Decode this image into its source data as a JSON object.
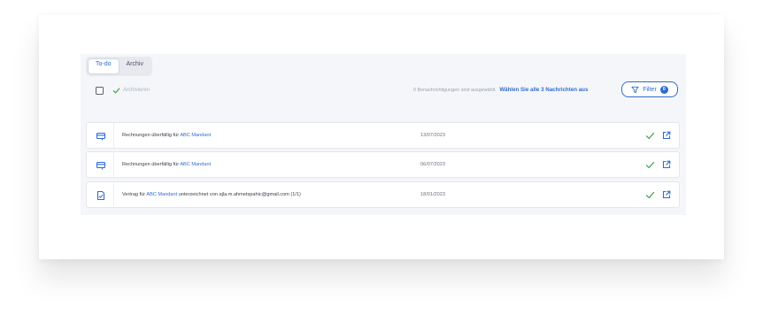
{
  "tabs": [
    {
      "label": "To-do",
      "active": true
    },
    {
      "label": "Archiv",
      "active": false
    }
  ],
  "toolbar": {
    "archive_label": "Archivieren",
    "selection_text": "0 Benachrichtigungen sind ausgewählt.",
    "select_all_link": "Wählen Sie alle 3 Nachrichten aus",
    "filter_label": "Filter",
    "filter_count": "0"
  },
  "rows": [
    {
      "icon": "invoice-icon",
      "text": "Rechnungen überfällig für ",
      "link": "ABC Mandant",
      "text_after": "",
      "date": "13/07/2023"
    },
    {
      "icon": "invoice-icon",
      "text": "Rechnungen überfällig für ",
      "link": "ABC Mandant",
      "text_after": "",
      "date": "06/07/2023"
    },
    {
      "icon": "document-icon",
      "text": "Vertrag für ",
      "link": "ABC Mandant",
      "text_after": " unterzeichnet von ajla.m.ahmetspahic@gmail.com (1/1)",
      "date": "18/01/2023"
    }
  ],
  "colors": {
    "accent": "#2f6bd1",
    "check": "#3aa14a",
    "panel": "#f5f6f9"
  }
}
